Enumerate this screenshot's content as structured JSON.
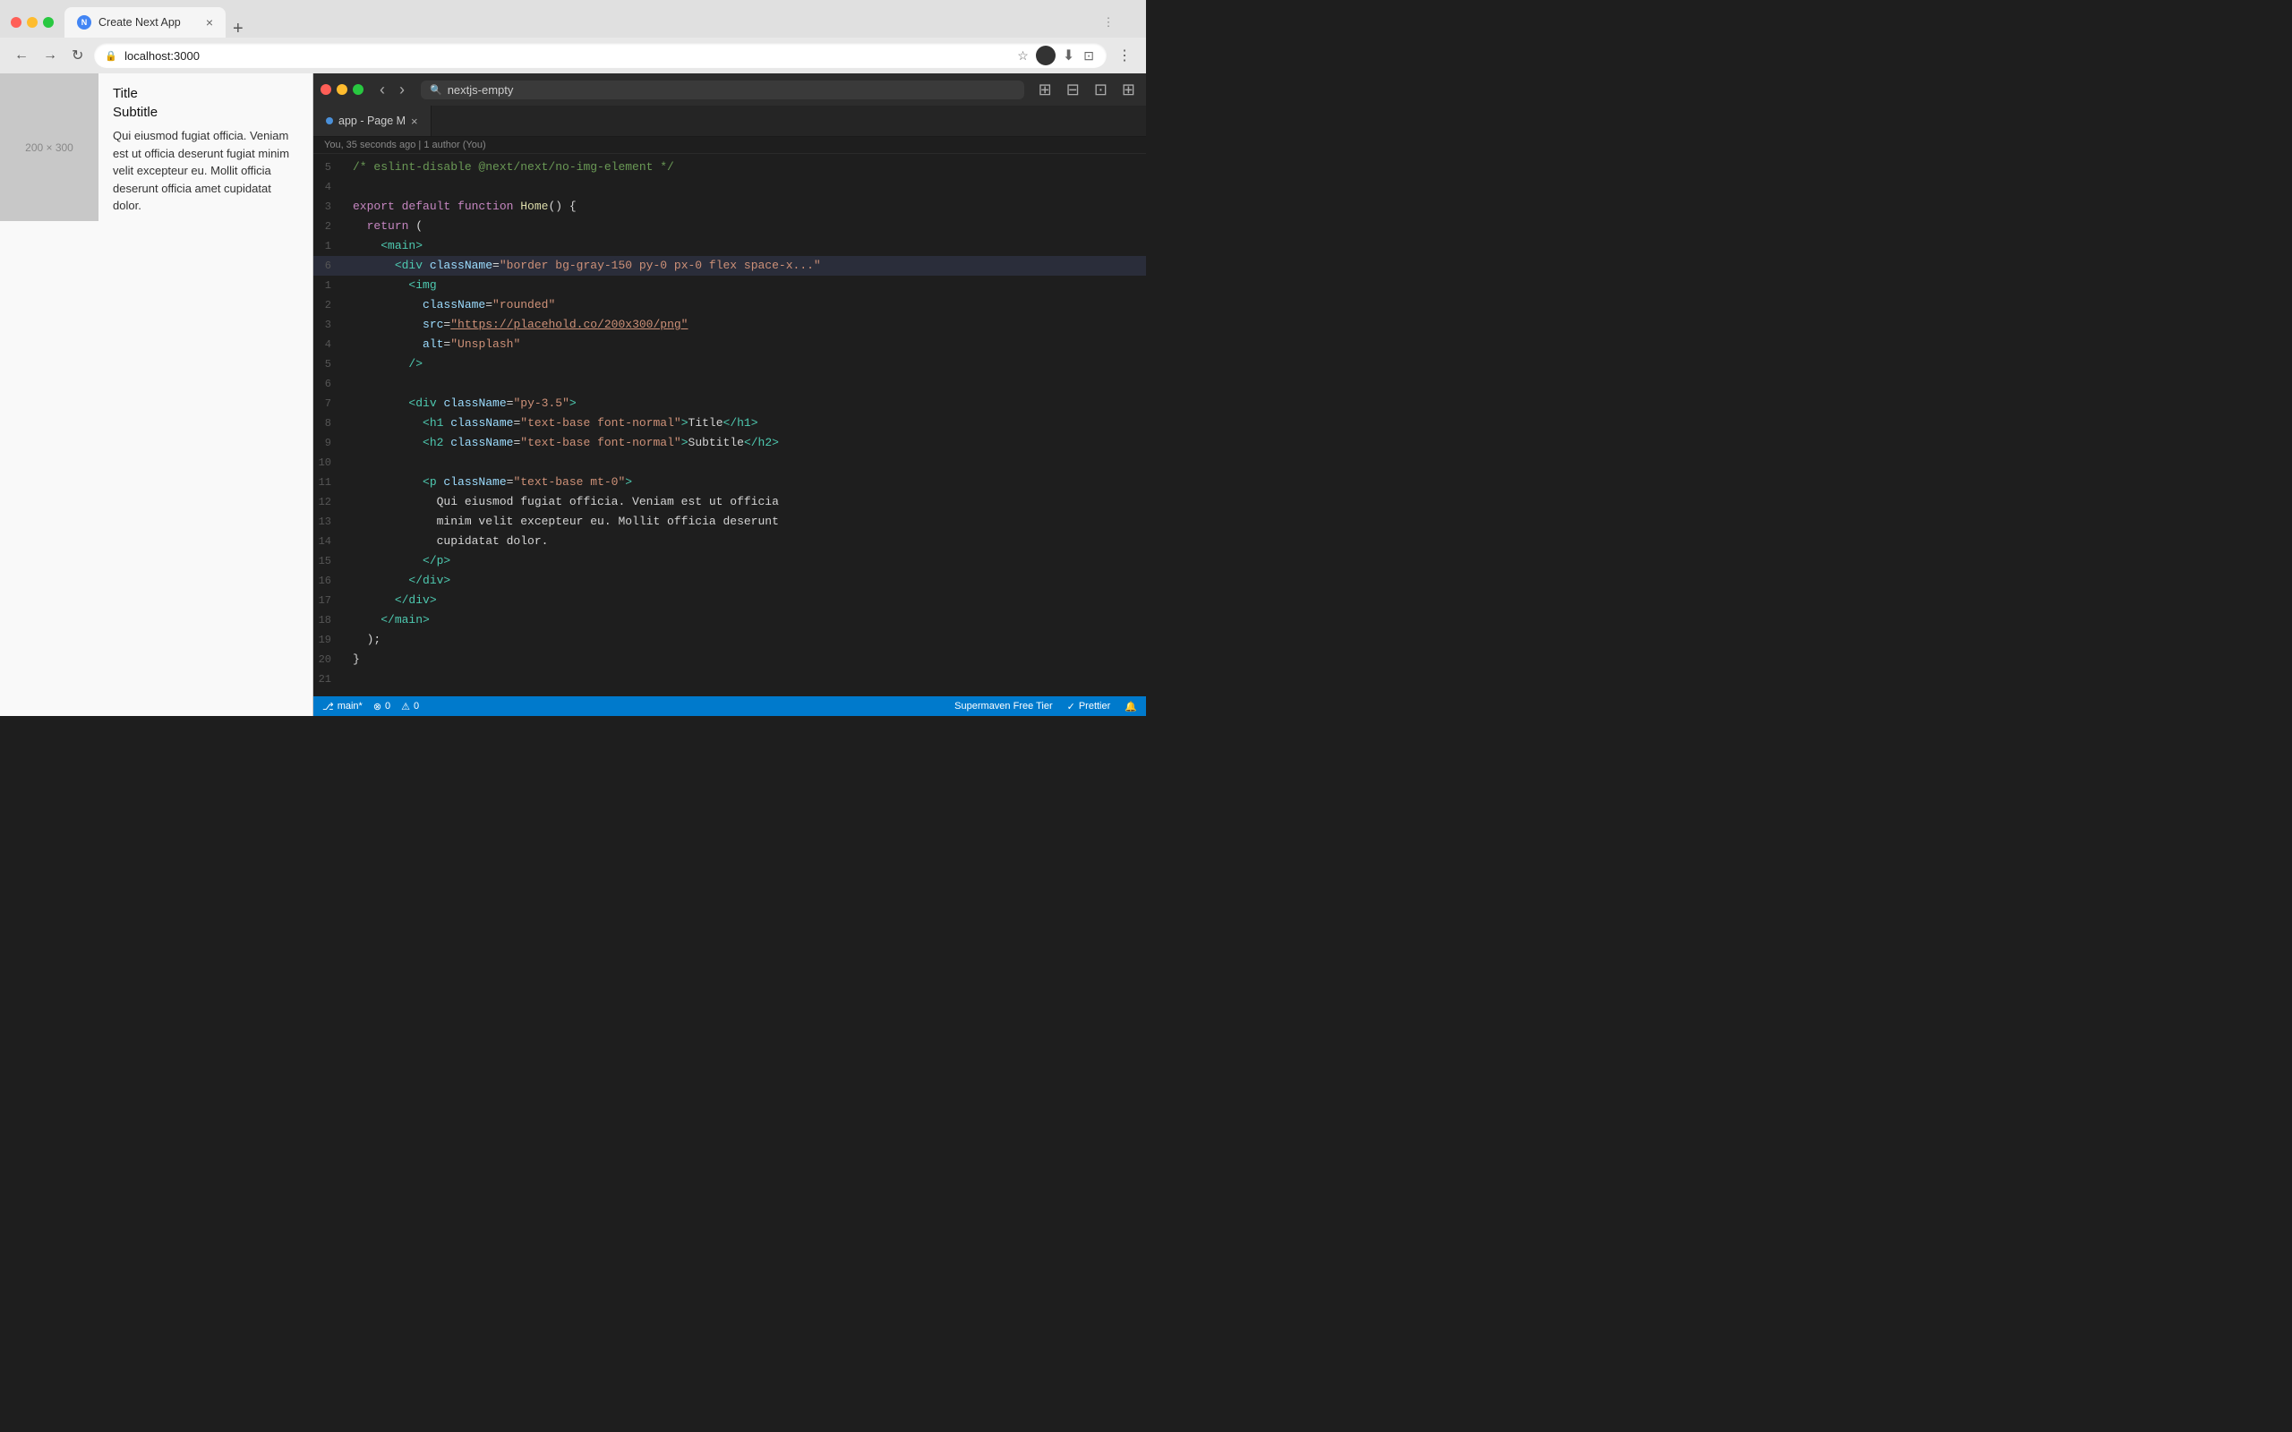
{
  "browser": {
    "tab_favicon": "N",
    "tab_title": "Create Next App",
    "tab_close": "×",
    "new_tab": "+",
    "url": "localhost:3000",
    "nav": {
      "back": "←",
      "forward": "→",
      "reload": "↻"
    },
    "menu_icon": "⋮"
  },
  "webpage": {
    "image_placeholder": "200 × 300",
    "title": "Title",
    "subtitle": "Subtitle",
    "body": "Qui eiusmod fugiat officia. Veniam est ut officia deserunt fugiat minim velit excepteur eu. Mollit officia deserunt officia amet cupidatat dolor."
  },
  "editor": {
    "search_text": "nextjs-empty",
    "tab_name": "app - Page M",
    "tab_close": "×",
    "git_blame": "You, 35 seconds ago | 1 author (You)",
    "lines": [
      {
        "num": "5",
        "tokens": [
          {
            "type": "cm",
            "text": "/* eslint-disable @next/next/no-img-element */"
          }
        ]
      },
      {
        "num": "4",
        "tokens": []
      },
      {
        "num": "3",
        "tokens": [
          {
            "type": "kw",
            "text": "export default "
          },
          {
            "type": "kw",
            "text": "function "
          },
          {
            "type": "fn",
            "text": "Home"
          },
          {
            "type": "plain",
            "text": "() {"
          }
        ]
      },
      {
        "num": "2",
        "tokens": [
          {
            "type": "plain",
            "text": "  "
          },
          {
            "type": "kw",
            "text": "return "
          },
          {
            "type": "pun",
            "text": "("
          }
        ]
      },
      {
        "num": "1",
        "tokens": [
          {
            "type": "plain",
            "text": "    "
          },
          {
            "type": "tag",
            "text": "<main>"
          }
        ]
      },
      {
        "num": "6",
        "tokens": [
          {
            "type": "plain",
            "text": "      "
          },
          {
            "type": "tag",
            "text": "<div "
          },
          {
            "type": "attr",
            "text": "className"
          },
          {
            "type": "plain",
            "text": "="
          },
          {
            "type": "str",
            "text": "\"border bg-gray-150 py-0 px-0 flex space-x...\""
          }
        ],
        "highlighted": true
      },
      {
        "num": "1",
        "tokens": [
          {
            "type": "plain",
            "text": "        "
          },
          {
            "type": "tag",
            "text": "<img"
          }
        ]
      },
      {
        "num": "2",
        "tokens": [
          {
            "type": "plain",
            "text": "          "
          },
          {
            "type": "attr",
            "text": "className"
          },
          {
            "type": "plain",
            "text": "="
          },
          {
            "type": "str",
            "text": "\"rounded\""
          }
        ]
      },
      {
        "num": "3",
        "tokens": [
          {
            "type": "plain",
            "text": "          "
          },
          {
            "type": "attr",
            "text": "src"
          },
          {
            "type": "plain",
            "text": "="
          },
          {
            "type": "str-link",
            "text": "\"https://placehold.co/200x300/png\""
          }
        ]
      },
      {
        "num": "4",
        "tokens": [
          {
            "type": "plain",
            "text": "          "
          },
          {
            "type": "attr",
            "text": "alt"
          },
          {
            "type": "plain",
            "text": "="
          },
          {
            "type": "str",
            "text": "\"Unsplash\""
          }
        ]
      },
      {
        "num": "5",
        "tokens": [
          {
            "type": "plain",
            "text": "        "
          },
          {
            "type": "tag",
            "text": "/>"
          }
        ]
      },
      {
        "num": "6",
        "tokens": []
      },
      {
        "num": "7",
        "tokens": [
          {
            "type": "plain",
            "text": "        "
          },
          {
            "type": "tag",
            "text": "<div "
          },
          {
            "type": "attr",
            "text": "className"
          },
          {
            "type": "plain",
            "text": "="
          },
          {
            "type": "str",
            "text": "\"py-3.5\""
          },
          {
            "type": "tag",
            "text": ">"
          }
        ]
      },
      {
        "num": "8",
        "tokens": [
          {
            "type": "plain",
            "text": "          "
          },
          {
            "type": "tag",
            "text": "<h1 "
          },
          {
            "type": "attr",
            "text": "className"
          },
          {
            "type": "plain",
            "text": "="
          },
          {
            "type": "str",
            "text": "\"text-base font-normal\""
          },
          {
            "type": "tag",
            "text": ">"
          },
          {
            "type": "plain",
            "text": "Title"
          },
          {
            "type": "tag",
            "text": "</h1>"
          }
        ]
      },
      {
        "num": "9",
        "tokens": [
          {
            "type": "plain",
            "text": "          "
          },
          {
            "type": "tag",
            "text": "<h2 "
          },
          {
            "type": "attr",
            "text": "className"
          },
          {
            "type": "plain",
            "text": "="
          },
          {
            "type": "str",
            "text": "\"text-base font-normal\""
          },
          {
            "type": "tag",
            "text": ">"
          },
          {
            "type": "plain",
            "text": "Subtitle"
          },
          {
            "type": "tag",
            "text": "</h2>"
          }
        ]
      },
      {
        "num": "10",
        "tokens": []
      },
      {
        "num": "11",
        "tokens": [
          {
            "type": "plain",
            "text": "          "
          },
          {
            "type": "tag",
            "text": "<p "
          },
          {
            "type": "attr",
            "text": "className"
          },
          {
            "type": "plain",
            "text": "="
          },
          {
            "type": "str",
            "text": "\"text-base mt-0\""
          },
          {
            "type": "tag",
            "text": ">"
          }
        ]
      },
      {
        "num": "12",
        "tokens": [
          {
            "type": "plain",
            "text": "            Qui eiusmod fugiat officia. Veniam est ut officia"
          }
        ]
      },
      {
        "num": "13",
        "tokens": [
          {
            "type": "plain",
            "text": "            minim velit excepteur eu. Mollit officia deserunt"
          }
        ]
      },
      {
        "num": "14",
        "tokens": [
          {
            "type": "plain",
            "text": "            cupidatat dolor."
          }
        ]
      },
      {
        "num": "15",
        "tokens": [
          {
            "type": "plain",
            "text": "          "
          },
          {
            "type": "tag",
            "text": "</p>"
          }
        ]
      },
      {
        "num": "16",
        "tokens": [
          {
            "type": "plain",
            "text": "        "
          },
          {
            "type": "tag",
            "text": "</div>"
          }
        ]
      },
      {
        "num": "17",
        "tokens": [
          {
            "type": "plain",
            "text": "      "
          },
          {
            "type": "tag",
            "text": "</div>"
          }
        ]
      },
      {
        "num": "18",
        "tokens": [
          {
            "type": "plain",
            "text": "    "
          },
          {
            "type": "tag",
            "text": "</main>"
          }
        ]
      },
      {
        "num": "19",
        "tokens": [
          {
            "type": "plain",
            "text": "  );"
          }
        ]
      },
      {
        "num": "20",
        "tokens": [
          {
            "type": "plain",
            "text": "}"
          }
        ]
      },
      {
        "num": "21",
        "tokens": []
      }
    ]
  },
  "statusbar": {
    "branch": "main*",
    "errors": "0",
    "warnings": "0",
    "supermaven": "Supermaven Free Tier",
    "prettier": "Prettier",
    "bell": "🔔"
  }
}
